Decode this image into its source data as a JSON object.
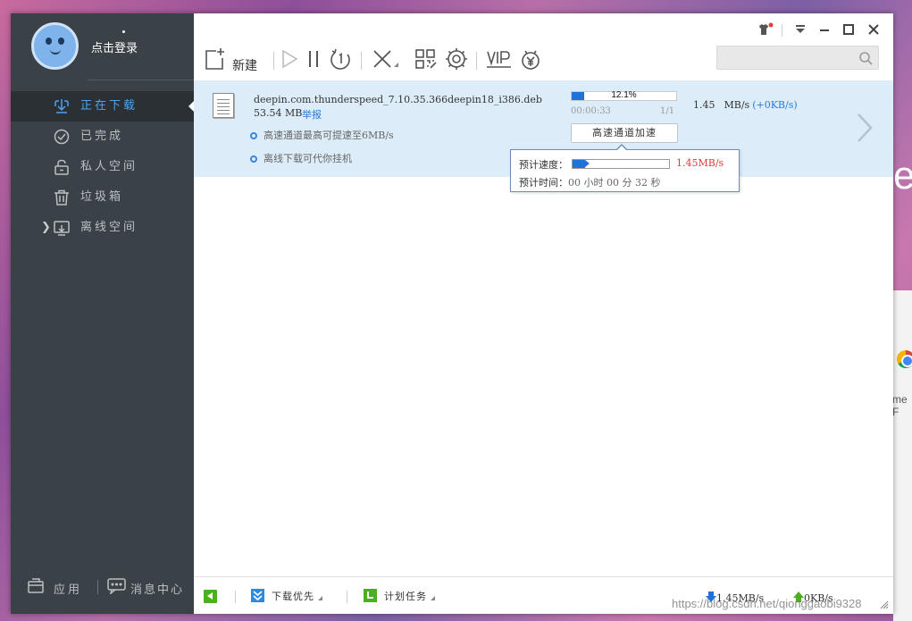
{
  "desktop": {
    "side_label": "me F"
  },
  "sidebar": {
    "login_label": "点击登录",
    "items": [
      {
        "label": "正在下载",
        "icon": "download-icon",
        "active": true
      },
      {
        "label": "已完成",
        "icon": "check-circle-icon"
      },
      {
        "label": "私人空间",
        "icon": "lock-icon"
      },
      {
        "label": "垃圾箱",
        "icon": "trash-icon"
      },
      {
        "label": "离线空间",
        "icon": "cloud-download-icon",
        "expandable": true
      }
    ],
    "apps_label": "应用",
    "messages_label": "消息中心"
  },
  "toolbar": {
    "new_label": "新建",
    "icons": [
      "new-task-icon",
      "play-icon",
      "pause-icon",
      "limit-speed-icon",
      "delete-icon",
      "qrcode-icon",
      "settings-icon",
      "vip-icon",
      "money-icon"
    ],
    "search_placeholder": ""
  },
  "download": {
    "file_name": "deepin.com.thunderspeed_7.10.35.366deepin18_i386.deb",
    "file_size": "53.54 MB",
    "report_label": "举报",
    "tip1": "高速通道最高可提速至6MB/s",
    "tip2": "离线下载可代你挂机",
    "progress_percent": 12.1,
    "progress_text": "12.1%",
    "elapsed": "00:00:33",
    "parts": "1/1",
    "speed_value": "1.45",
    "speed_unit": "MB/s",
    "speed_extra": "(+0KB/s)",
    "accel_button": "高速通道加速"
  },
  "popup": {
    "speed_label": "预计速度：",
    "speed_value": "1.45MB/s",
    "speed_fraction": 0.13,
    "time_label": "预计时间：",
    "time_value": "00 小时 00 分 32 秒"
  },
  "statusbar": {
    "priority_label": "下载优先",
    "schedule_label": "计划任务",
    "down_rate": "1.45MB/s",
    "up_rate": "0KB/s"
  },
  "watermark": "https://blog.csdn.net/qionggaobi9328",
  "colors": {
    "accent": "#2a7ad5",
    "sidebar": "#3b4247",
    "row_selected": "#dcecf8",
    "popup_speed": "#e03a3a"
  }
}
